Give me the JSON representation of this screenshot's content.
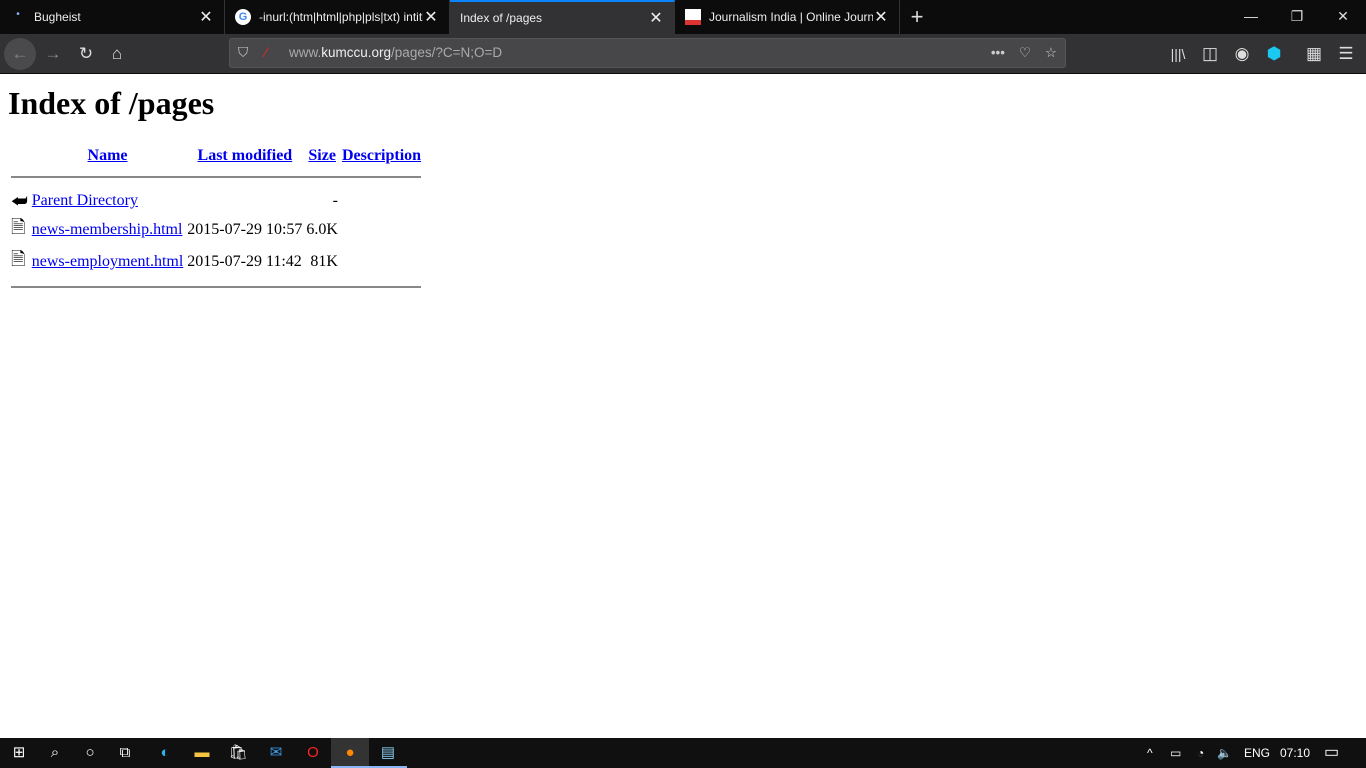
{
  "tabs": [
    {
      "title": "Bugheist"
    },
    {
      "title": "-inurl:(htm|html|php|pls|txt) intitle:index.of"
    },
    {
      "title": "Index of /pages",
      "active": true
    },
    {
      "title": "Journalism India | Online Journalism"
    }
  ],
  "url": {
    "domain_prefix": "www.",
    "domain": "kumccu.org",
    "path": "/pages/?C=N;O=D"
  },
  "page": {
    "title": "Index of /pages",
    "headers": {
      "name": "Name",
      "modified": "Last modified",
      "size": "Size",
      "description": "Description"
    },
    "rows": [
      {
        "name": "Parent Directory",
        "modified": "",
        "size": "-",
        "icon": "back-icon"
      },
      {
        "name": "news-membership.html",
        "modified": "2015-07-29 10:57",
        "size": "6.0K",
        "icon": "file-icon"
      },
      {
        "name": "news-employment.html",
        "modified": "2015-07-29 11:42",
        "size": "81K",
        "icon": "file-icon"
      }
    ]
  },
  "taskbar": {
    "lang": "ENG",
    "time": "07:10"
  },
  "colors": {
    "accent": "#0a84ff",
    "link": "#0000ee"
  }
}
